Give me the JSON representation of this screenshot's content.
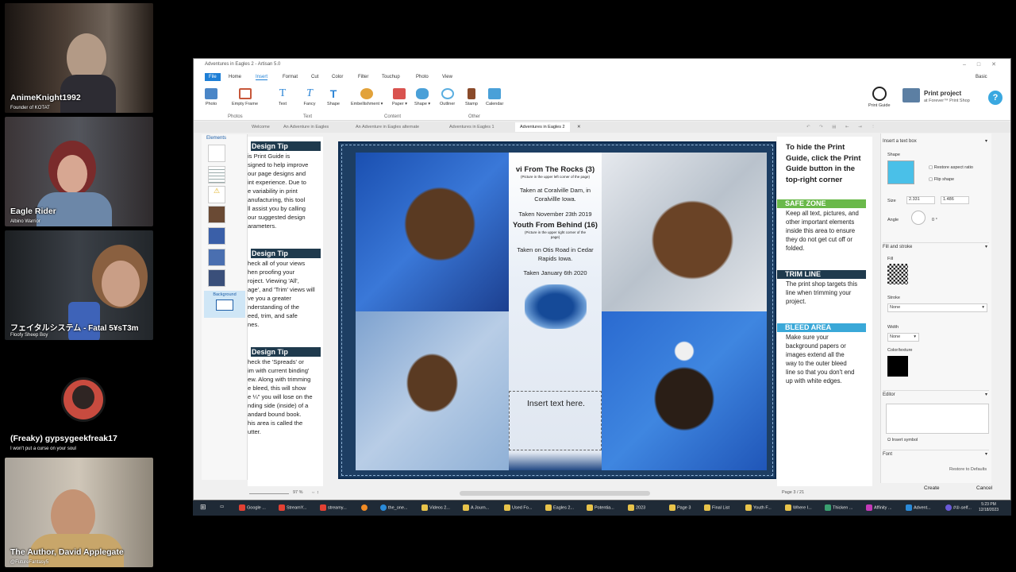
{
  "participants": [
    {
      "name": "AnimeKnight1992",
      "subtitle": "Founder of KOTAT"
    },
    {
      "name": "Eagle Rider",
      "subtitle": "Albino Warrior"
    },
    {
      "name": "フェイタルシステム - Fatal 5¥sT3m",
      "subtitle": "Floofy Sheep Boy"
    },
    {
      "name": "(Freaky) gypsygeekfreak17",
      "subtitle": "I won't put a curse on your soul"
    },
    {
      "name": "The Author, David Applegate",
      "subtitle": "@FutureFantasy5"
    }
  ],
  "app": {
    "title": "Adventures in Eagles 2 - Artisan 5.0",
    "mode": "Basic",
    "menu": [
      "File",
      "Home",
      "Insert",
      "Format",
      "Cut",
      "Color",
      "Filter",
      "Touchup",
      "Photo",
      "View"
    ],
    "ribbon": {
      "photos": [
        "Photo",
        "Empty Frame"
      ],
      "text": [
        "Text",
        "Fancy",
        "Shape"
      ],
      "content": [
        "Embellishment",
        "Paper",
        "Shape"
      ],
      "other": [
        "Outliner",
        "Stamp",
        "Calendar"
      ],
      "groups": [
        "Photos",
        "Text",
        "Content",
        "Other"
      ],
      "print_guide": "Print Guide",
      "print_project": "Print project",
      "print_project_sub": "at Forever™ Print Shop",
      "help": "?"
    },
    "tabs": [
      "Welcome",
      "An Adventure in Eagles",
      "An Adventure in Eagles alternate",
      "Adventures in Eagles 1",
      "Adventures in Eagles 2"
    ],
    "elements_label": "Elements",
    "background_label": "Background",
    "guide": {
      "tip1_title": "Design Tip",
      "tip1_lines": [
        "is Print Guide is",
        "signed to help improve",
        "our page designs and",
        "int experience. Due to",
        "e variability in print",
        "anufacturing, this tool",
        "ll assist you by calling",
        "our suggested design",
        "arameters."
      ],
      "tip2_title": "Design Tip",
      "tip2_lines": [
        "heck all of your views",
        "hen proofing your",
        "roject. Viewing 'All',",
        "age', and 'Trim' views will",
        "ve you a greater",
        "nderstanding of the",
        "eed, trim, and safe",
        "nes."
      ],
      "tip3_title": "Design Tip",
      "tip3_lines": [
        "heck the 'Spreads' or",
        "im with current binding'",
        "ew. Along with trimming",
        "e bleed, this will show",
        "e ¼\" you will lose on the",
        "nding side (inside) of a",
        "andard bound book.",
        "his area is called the",
        "utter."
      ]
    },
    "center": {
      "title": "vi From The Rocks (3)",
      "note1": "(Picture in the upper left corner of the page)",
      "line1": "Taken at Coralville Dam, in",
      "line2": "Coralvillle Iowa.",
      "date1": "Taken November 23th 2019",
      "title2": "Youth From Behind (16)",
      "note2a": "(Picture in the upper right corner of the",
      "note2b": "page)",
      "line3": "Taken on Otis Road in Cedar",
      "line4": "Rapids Iowa.",
      "date2": "Taken January 6th 2020",
      "insert": "Insert text here."
    },
    "right_guide": {
      "hide_lines": [
        "To hide the Print",
        "Guide, click the Print",
        "Guide button in the",
        "top-right corner"
      ],
      "safe_title": "SAFE ZONE",
      "safe_lines": [
        "Keep all text, pictures, and",
        "other important elements",
        "inside this area to ensure",
        "they do not get cut off or",
        "folded."
      ],
      "trim_title": "TRIM LINE",
      "trim_lines": [
        "The print shop targets this",
        "line when trimming your",
        "project."
      ],
      "bleed_title": "BLEED AREA",
      "bleed_lines": [
        "Make sure your",
        "background papers or",
        "images extend all the",
        "way to the outer bleed",
        "line so that you don't end",
        "up with white edges."
      ]
    },
    "props": {
      "insert_title": "Insert a text box",
      "shape_label": "Shape",
      "restore_aspect": "Restore aspect ratio",
      "flip_shape": "Flip shape",
      "size_label": "Size",
      "size_w": "2.331",
      "size_h": "1.486",
      "angle_label": "Angle",
      "angle_val": "0 °",
      "fill_stroke": "Fill and stroke",
      "fill_label": "Fill",
      "stroke_label": "Stroke",
      "stroke_val": "None",
      "width_label": "Width",
      "width_val": "None",
      "color_label": "Color/texture",
      "editor_label": "Editor",
      "insert_symbol": "Insert symbol",
      "font_label": "Font",
      "restore_defaults": "Restore to Defaults",
      "create": "Create",
      "cancel": "Cancel"
    },
    "zoom": "97 %",
    "page_num": "Page 3 / 21"
  },
  "taskbar": {
    "items": [
      "Google ...",
      "StreamY...",
      "streamy...",
      "the_one...",
      "Videos 2...",
      "A Journ...",
      "Used Fo...",
      "Eagles 2...",
      "Potentia...",
      "2023",
      "Page 3",
      "Final List",
      "Youth F...",
      "Where I...",
      "Thicken ...",
      "Affinity ...",
      "Advent...",
      "#②-self..."
    ],
    "time": "5:23 PM",
    "date": "12/18/2023"
  },
  "colors": {
    "page_bg": "#1d3e63",
    "safe": "#6ab94a",
    "trim": "#1f3a4d",
    "bleed": "#3aa8d8",
    "app_accent": "#1e7fd6"
  }
}
